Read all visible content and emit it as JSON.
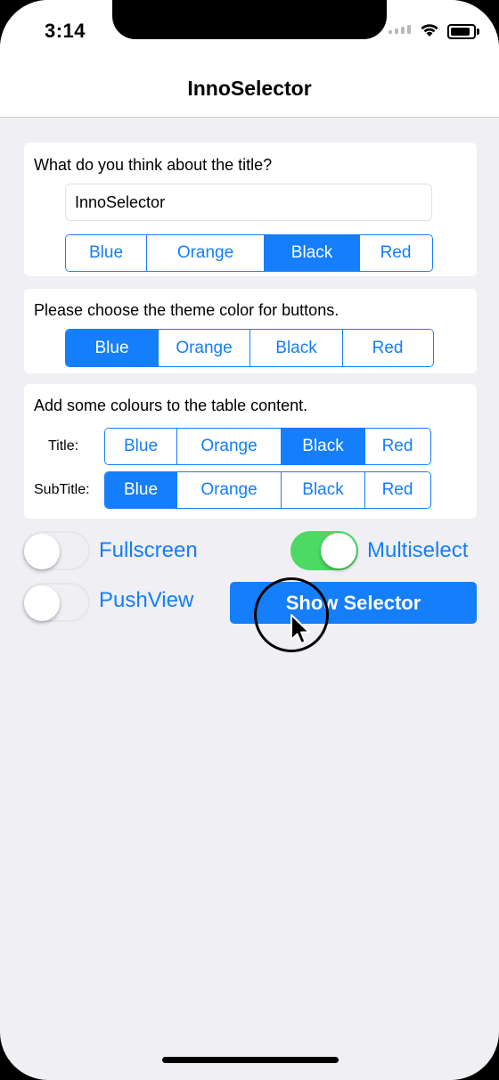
{
  "status_bar": {
    "time": "3:14"
  },
  "nav": {
    "title": "InnoSelector"
  },
  "title_card": {
    "question": "What do you think about the title?",
    "text_value": "InnoSelector",
    "options": [
      "Blue",
      "Orange",
      "Black",
      "Red"
    ],
    "selected": "Black"
  },
  "theme_card": {
    "question": "Please choose the theme color for buttons.",
    "options": [
      "Blue",
      "Orange",
      "Black",
      "Red"
    ],
    "selected": "Blue"
  },
  "content_card": {
    "question": "Add some colours to the table content.",
    "title_label": "Title:",
    "title_options": [
      "Blue",
      "Orange",
      "Black",
      "Red"
    ],
    "title_selected": "Black",
    "subtitle_label": "SubTitle:",
    "subtitle_options": [
      "Blue",
      "Orange",
      "Black",
      "Red"
    ],
    "subtitle_selected": "Blue"
  },
  "toggles": {
    "fullscreen": {
      "label": "Fullscreen",
      "on": false
    },
    "multiselect": {
      "label": "Multiselect",
      "on": true
    },
    "pushview": {
      "label": "PushView",
      "on": false
    }
  },
  "show_button": {
    "label": "Show Selector"
  },
  "colors": {
    "accent": "#147efb",
    "toggle_on": "#4cd964",
    "background": "#efeff4"
  }
}
